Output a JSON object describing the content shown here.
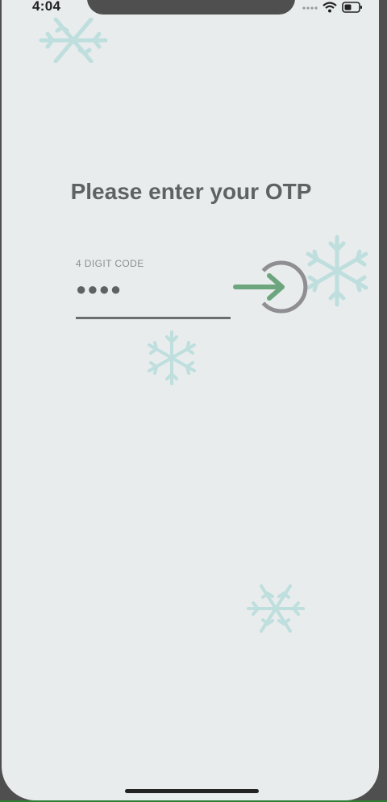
{
  "status_bar": {
    "time": "4:04",
    "icons": [
      "signal-icon",
      "wifi-icon",
      "battery-icon"
    ]
  },
  "page": {
    "title": "Please enter your OTP"
  },
  "otp": {
    "label": "4 DIGIT CODE",
    "masked_value": "●●●●"
  },
  "submit": {
    "icon": "login-arrow-icon"
  },
  "decorations": {
    "icon": "snowflake-icon",
    "count": 4
  },
  "colors": {
    "background": "#e8ecec",
    "text": "#5f6264",
    "arrow": "#6ca57e",
    "ring": "#8e8e93",
    "snowflake": "#a6d8d8"
  }
}
